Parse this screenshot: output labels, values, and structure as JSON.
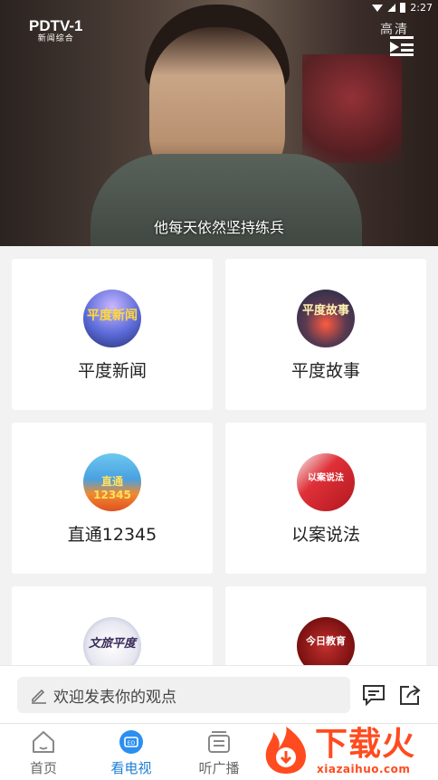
{
  "status": {
    "time": "2:27"
  },
  "video": {
    "channel_logo": "PDTV-1",
    "channel_sub": "新闻综合",
    "quality": "高清",
    "subtitle": "他每天依然坚持练兵"
  },
  "programs": [
    {
      "title": "平度新闻",
      "thumb_text": "平度新闻"
    },
    {
      "title": "平度故事",
      "thumb_text": "平度故事"
    },
    {
      "title": "直通12345",
      "thumb_text": "直通12345"
    },
    {
      "title": "以案说法",
      "thumb_text": "以案说法"
    },
    {
      "title": "",
      "thumb_text": "文旅平度"
    },
    {
      "title": "",
      "thumb_text": "今日教育"
    }
  ],
  "comment": {
    "placeholder": "欢迎发表你的观点"
  },
  "tabs": [
    {
      "label": "首页",
      "icon": "home-icon"
    },
    {
      "label": "看电视",
      "icon": "tv-icon",
      "active": true
    },
    {
      "label": "听广播",
      "icon": "radio-icon"
    }
  ],
  "watermark": {
    "text": "下载火",
    "domain": "xiazaihuo.com"
  },
  "colors": {
    "accent": "#1e7ed6",
    "watermark": "#ff4b1f",
    "background": "#f2f2f2"
  }
}
